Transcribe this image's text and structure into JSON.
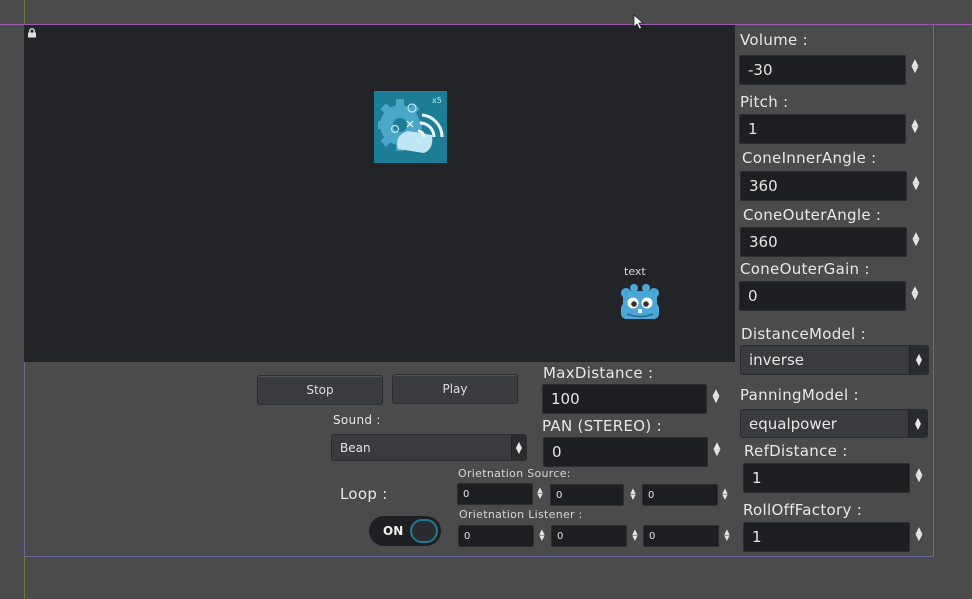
{
  "right_panel": {
    "volume": {
      "label": "Volume :",
      "value": "-30"
    },
    "pitch": {
      "label": "Pitch :",
      "value": "1"
    },
    "cone_inner_angle": {
      "label": "ConeInnerAngle :",
      "value": "360"
    },
    "cone_outer_angle": {
      "label": "ConeOuterAngle :",
      "value": "360"
    },
    "cone_outer_gain": {
      "label": "ConeOuterGain :",
      "value": "0"
    },
    "distance_model": {
      "label": "DistanceModel :",
      "value": "inverse"
    },
    "panning_model": {
      "label": "PanningModel :",
      "value": "equalpower"
    },
    "ref_distance": {
      "label": "RefDistance :",
      "value": "1"
    },
    "rolloff_factory": {
      "label": "RollOffFactory :",
      "value": "1"
    }
  },
  "viewport": {
    "listener_label": "text"
  },
  "controls": {
    "stop_label": "Stop",
    "play_label": "Play",
    "sound_label": "Sound :",
    "sound_value": "Bean",
    "loop_label": "Loop :",
    "loop_toggle": "ON",
    "max_distance": {
      "label": "MaxDistance :",
      "value": "100"
    },
    "pan": {
      "label": "PAN (STEREO) :",
      "value": "0"
    },
    "orientation_source": {
      "label": "Orietnation Source:",
      "values": [
        "0",
        "0",
        "0"
      ]
    },
    "orientation_listener": {
      "label": "Orietnation Listener :",
      "values": [
        "0",
        "0",
        "0"
      ]
    }
  },
  "colors": {
    "background": "#4b4b4b",
    "viewport": "#232428",
    "accent": "#1d7c96"
  }
}
